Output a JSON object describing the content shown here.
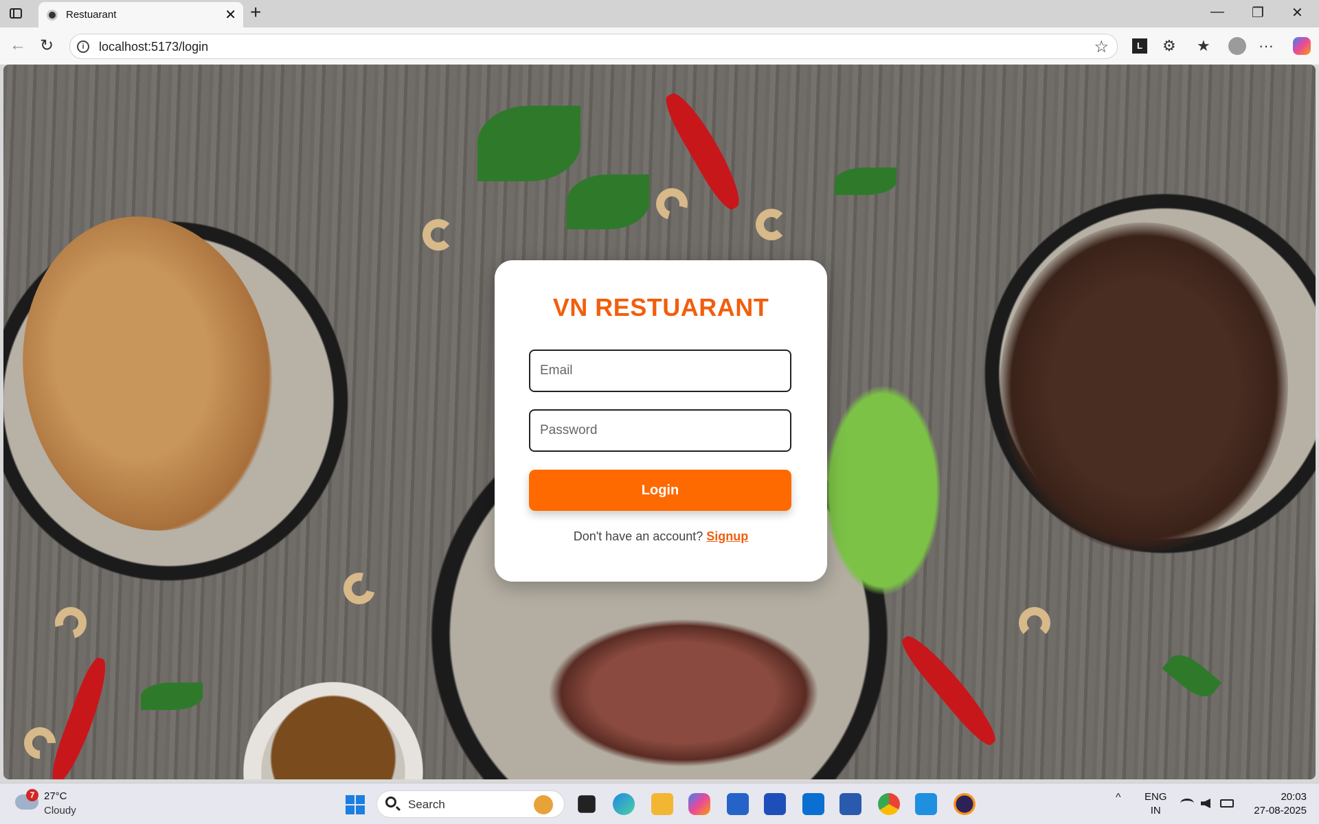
{
  "browser": {
    "tab_title": "Restuarant",
    "tab_close": "✕",
    "new_tab": "+",
    "window_minimize": "—",
    "window_restore": "❐",
    "window_close": "✕",
    "back_icon": "←",
    "reload_icon": "↻",
    "url": "localhost:5173/login",
    "info_icon": "i",
    "favorite_icon": "☆",
    "extension_l_label": "L",
    "extensions_icon": "⚙",
    "favorites_icon": "★",
    "more_icon": "···"
  },
  "login": {
    "brand_title": "VN RESTUARANT",
    "email_placeholder": "Email",
    "email_value": "",
    "password_placeholder": "Password",
    "password_value": "",
    "login_button": "Login",
    "signup_prompt": "Don't have an account?",
    "signup_link": "Signup"
  },
  "colors": {
    "brand_orange": "#f25e0c",
    "button_orange": "#ff6a00"
  },
  "taskbar": {
    "weather_badge": "7",
    "temperature": "27°C",
    "condition": "Cloudy",
    "search_label": "Search",
    "apps": [
      "task-view",
      "edge",
      "file-explorer",
      "copilot",
      "microsoft-store",
      "app-yellow",
      "outlook",
      "word",
      "chrome",
      "vs-code",
      "eclipse"
    ],
    "tray_chevron": "^",
    "lang_line1": "ENG",
    "lang_line2": "IN",
    "wifi_icon": "wifi-icon",
    "volume_icon": "volume-icon",
    "battery_icon": "battery-icon",
    "time": "20:03",
    "date": "27-08-2025"
  }
}
